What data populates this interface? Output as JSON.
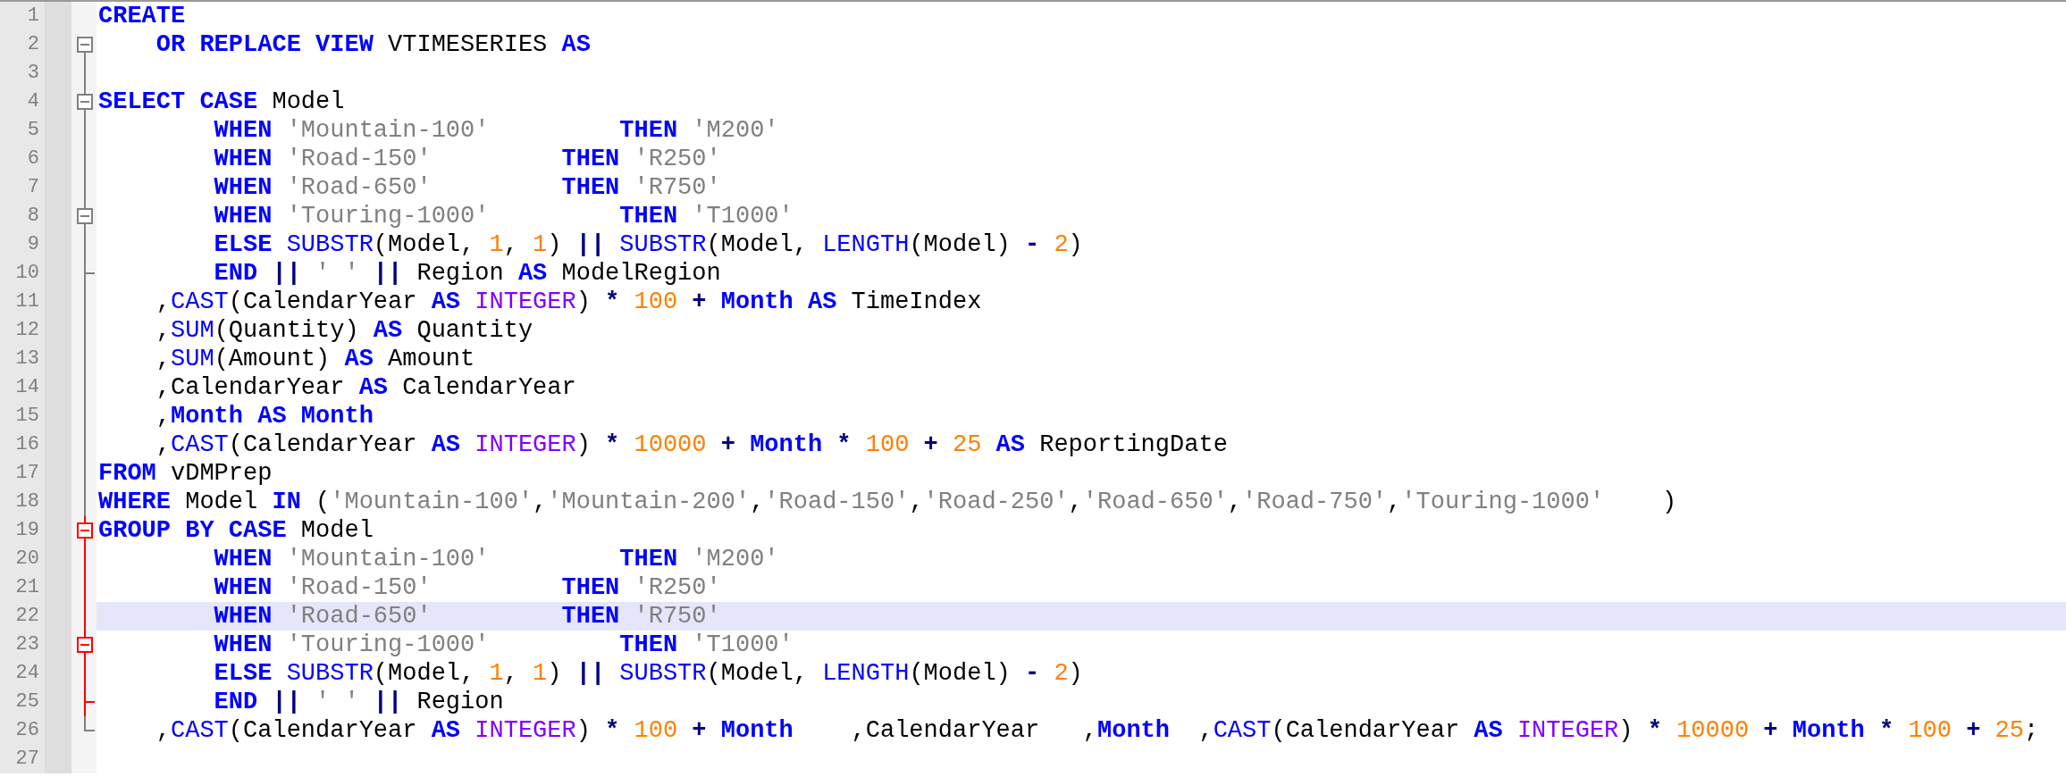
{
  "editor": {
    "lines": [
      {
        "number": "1",
        "selected": false,
        "kind": "none",
        "tokens": [
          {
            "kind": "kw",
            "text": "CREATE"
          }
        ]
      },
      {
        "number": "2",
        "selected": false,
        "kind": "start",
        "expanded": true,
        "fold_active": false,
        "tokens": [
          {
            "kind": "kw",
            "text": "    OR REPLACE VIEW "
          },
          {
            "kind": "plain",
            "text": "VTIMESERIES "
          },
          {
            "kind": "kw",
            "text": "AS"
          }
        ]
      },
      {
        "number": "3",
        "selected": false,
        "kind": "line",
        "fold_active": false
      },
      {
        "number": "4",
        "selected": false,
        "kind": "start",
        "expanded": true,
        "fold_active": false,
        "tokens": [
          {
            "kind": "kw",
            "text": "SELECT CASE "
          },
          {
            "kind": "plain",
            "text": "Model"
          }
        ]
      },
      {
        "number": "5",
        "selected": false,
        "kind": "line",
        "fold_active": false,
        "tokens": [
          {
            "kind": "kw",
            "text": "        WHEN "
          },
          {
            "kind": "str",
            "text": "'Mountain-100'         "
          },
          {
            "kind": "kw",
            "text": "THEN "
          },
          {
            "kind": "str",
            "text": "'M200'"
          }
        ]
      },
      {
        "number": "6",
        "selected": false,
        "kind": "line",
        "fold_active": false,
        "tokens": [
          {
            "kind": "kw",
            "text": "        WHEN "
          },
          {
            "kind": "str",
            "text": "'Road-150'         "
          },
          {
            "kind": "kw",
            "text": "THEN "
          },
          {
            "kind": "str",
            "text": "'R250'"
          }
        ]
      },
      {
        "number": "7",
        "selected": false,
        "kind": "line",
        "fold_active": false,
        "tokens": [
          {
            "kind": "kw",
            "text": "        WHEN "
          },
          {
            "kind": "str",
            "text": "'Road-650'         "
          },
          {
            "kind": "kw",
            "text": "THEN "
          },
          {
            "kind": "str",
            "text": "'R750'"
          }
        ]
      },
      {
        "number": "8",
        "selected": false,
        "kind": "start",
        "expanded": true,
        "fold_active": false,
        "tokens": [
          {
            "kind": "kw",
            "text": "        WHEN "
          },
          {
            "kind": "str",
            "text": "'Touring-1000'         "
          },
          {
            "kind": "kw",
            "text": "THEN "
          },
          {
            "kind": "str",
            "text": "'T1000'"
          }
        ]
      },
      {
        "number": "9",
        "selected": false,
        "kind": "line",
        "fold_active": false,
        "tokens": [
          {
            "kind": "kw",
            "text": "        ELSE "
          },
          {
            "kind": "fn",
            "text": "SUBSTR"
          },
          {
            "kind": "plain",
            "text": "(Model, "
          },
          {
            "kind": "num",
            "text": "1"
          },
          {
            "kind": "plain",
            "text": ", "
          },
          {
            "kind": "num",
            "text": "1"
          },
          {
            "kind": "plain",
            "text": ") "
          },
          {
            "kind": "op",
            "text": "|| "
          },
          {
            "kind": "fn",
            "text": "SUBSTR"
          },
          {
            "kind": "plain",
            "text": "(Model, "
          },
          {
            "kind": "fn",
            "text": "LENGTH"
          },
          {
            "kind": "plain",
            "text": "(Model) "
          },
          {
            "kind": "op",
            "text": "- "
          },
          {
            "kind": "num",
            "text": "2"
          },
          {
            "kind": "plain",
            "text": ")"
          }
        ]
      },
      {
        "number": "10",
        "selected": false,
        "kind": "end",
        "fold_active": false,
        "tokens": [
          {
            "kind": "kw",
            "text": "        END "
          },
          {
            "kind": "op",
            "text": "|| "
          },
          {
            "kind": "str",
            "text": "' ' "
          },
          {
            "kind": "op",
            "text": "|| "
          },
          {
            "kind": "plain",
            "text": "Region "
          },
          {
            "kind": "kw",
            "text": "AS "
          },
          {
            "kind": "plain",
            "text": "ModelRegion"
          }
        ]
      },
      {
        "number": "11",
        "selected": false,
        "kind": "line",
        "fold_active": false,
        "tokens": [
          {
            "kind": "plain",
            "text": "    ,"
          },
          {
            "kind": "fn",
            "text": "CAST"
          },
          {
            "kind": "plain",
            "text": "(CalendarYear "
          },
          {
            "kind": "kw",
            "text": "AS "
          },
          {
            "kind": "type",
            "text": "INTEGER"
          },
          {
            "kind": "plain",
            "text": ") "
          },
          {
            "kind": "op",
            "text": "* "
          },
          {
            "kind": "num",
            "text": "100 "
          },
          {
            "kind": "op",
            "text": "+ "
          },
          {
            "kind": "kw",
            "text": "Month AS "
          },
          {
            "kind": "plain",
            "text": "TimeIndex"
          }
        ]
      },
      {
        "number": "12",
        "selected": false,
        "kind": "line",
        "fold_active": false,
        "tokens": [
          {
            "kind": "plain",
            "text": "    ,"
          },
          {
            "kind": "fn",
            "text": "SUM"
          },
          {
            "kind": "plain",
            "text": "(Quantity) "
          },
          {
            "kind": "kw",
            "text": "AS "
          },
          {
            "kind": "plain",
            "text": "Quantity"
          }
        ]
      },
      {
        "number": "13",
        "selected": false,
        "kind": "line",
        "fold_active": false,
        "tokens": [
          {
            "kind": "plain",
            "text": "    ,"
          },
          {
            "kind": "fn",
            "text": "SUM"
          },
          {
            "kind": "plain",
            "text": "(Amount) "
          },
          {
            "kind": "kw",
            "text": "AS "
          },
          {
            "kind": "plain",
            "text": "Amount"
          }
        ]
      },
      {
        "number": "14",
        "selected": false,
        "kind": "line",
        "fold_active": false,
        "tokens": [
          {
            "kind": "plain",
            "text": "    ,CalendarYear "
          },
          {
            "kind": "kw",
            "text": "AS "
          },
          {
            "kind": "plain",
            "text": "CalendarYear"
          }
        ]
      },
      {
        "number": "15",
        "selected": false,
        "kind": "line",
        "fold_active": false,
        "tokens": [
          {
            "kind": "plain",
            "text": "    ,"
          },
          {
            "kind": "kw",
            "text": "Month AS Month"
          }
        ]
      },
      {
        "number": "16",
        "selected": false,
        "kind": "line",
        "fold_active": false,
        "tokens": [
          {
            "kind": "plain",
            "text": "    ,"
          },
          {
            "kind": "fn",
            "text": "CAST"
          },
          {
            "kind": "plain",
            "text": "(CalendarYear "
          },
          {
            "kind": "kw",
            "text": "AS "
          },
          {
            "kind": "type",
            "text": "INTEGER"
          },
          {
            "kind": "plain",
            "text": ") "
          },
          {
            "kind": "op",
            "text": "* "
          },
          {
            "kind": "num",
            "text": "10000 "
          },
          {
            "kind": "op",
            "text": "+ "
          },
          {
            "kind": "kw",
            "text": "Month "
          },
          {
            "kind": "op",
            "text": "* "
          },
          {
            "kind": "num",
            "text": "100 "
          },
          {
            "kind": "op",
            "text": "+ "
          },
          {
            "kind": "num",
            "text": "25 "
          },
          {
            "kind": "kw",
            "text": "AS "
          },
          {
            "kind": "plain",
            "text": "ReportingDate"
          }
        ]
      },
      {
        "number": "17",
        "selected": false,
        "kind": "line",
        "fold_active": false,
        "tokens": [
          {
            "kind": "kw",
            "text": "FROM "
          },
          {
            "kind": "plain",
            "text": "vDMPrep"
          }
        ]
      },
      {
        "number": "18",
        "selected": false,
        "kind": "line",
        "fold_active": false,
        "tokens": [
          {
            "kind": "kw",
            "text": "WHERE "
          },
          {
            "kind": "plain",
            "text": "Model "
          },
          {
            "kind": "kw",
            "text": "IN "
          },
          {
            "kind": "plain",
            "text": "("
          },
          {
            "kind": "str",
            "text": "'Mountain-100'"
          },
          {
            "kind": "plain",
            "text": ","
          },
          {
            "kind": "str",
            "text": "'Mountain-200'"
          },
          {
            "kind": "plain",
            "text": ","
          },
          {
            "kind": "str",
            "text": "'Road-150'"
          },
          {
            "kind": "plain",
            "text": ","
          },
          {
            "kind": "str",
            "text": "'Road-250'"
          },
          {
            "kind": "plain",
            "text": ","
          },
          {
            "kind": "str",
            "text": "'Road-650'"
          },
          {
            "kind": "plain",
            "text": ","
          },
          {
            "kind": "str",
            "text": "'Road-750'"
          },
          {
            "kind": "plain",
            "text": ","
          },
          {
            "kind": "str",
            "text": "'Touring-1000'    "
          },
          {
            "kind": "plain",
            "text": ")"
          }
        ]
      },
      {
        "number": "19",
        "selected": false,
        "kind": "start",
        "expanded": true,
        "fold_active": true,
        "tokens": [
          {
            "kind": "kw",
            "text": "GROUP BY CASE "
          },
          {
            "kind": "plain",
            "text": "Model"
          }
        ]
      },
      {
        "number": "20",
        "selected": false,
        "kind": "line",
        "fold_active": true,
        "tokens": [
          {
            "kind": "kw",
            "text": "        WHEN "
          },
          {
            "kind": "str",
            "text": "'Mountain-100'         "
          },
          {
            "kind": "kw",
            "text": "THEN "
          },
          {
            "kind": "str",
            "text": "'M200'"
          }
        ]
      },
      {
        "number": "21",
        "selected": false,
        "kind": "line",
        "fold_active": true,
        "tokens": [
          {
            "kind": "kw",
            "text": "        WHEN "
          },
          {
            "kind": "str",
            "text": "'Road-150'         "
          },
          {
            "kind": "kw",
            "text": "THEN "
          },
          {
            "kind": "str",
            "text": "'R250'"
          }
        ]
      },
      {
        "number": "22",
        "selected": true,
        "kind": "line",
        "fold_active": true,
        "tokens": [
          {
            "kind": "kw",
            "text": "        WHEN "
          },
          {
            "kind": "str",
            "text": "'Road-650'         "
          },
          {
            "kind": "kw",
            "text": "THEN "
          },
          {
            "kind": "str",
            "text": "'R750'"
          }
        ]
      },
      {
        "number": "23",
        "selected": false,
        "kind": "start",
        "expanded": true,
        "fold_active": true,
        "tokens": [
          {
            "kind": "kw",
            "text": "        WHEN "
          },
          {
            "kind": "str",
            "text": "'Touring-1000'         "
          },
          {
            "kind": "kw",
            "text": "THEN "
          },
          {
            "kind": "str",
            "text": "'T1000'"
          }
        ]
      },
      {
        "number": "24",
        "selected": false,
        "kind": "line",
        "fold_active": true,
        "tokens": [
          {
            "kind": "kw",
            "text": "        ELSE "
          },
          {
            "kind": "fn",
            "text": "SUBSTR"
          },
          {
            "kind": "plain",
            "text": "(Model, "
          },
          {
            "kind": "num",
            "text": "1"
          },
          {
            "kind": "plain",
            "text": ", "
          },
          {
            "kind": "num",
            "text": "1"
          },
          {
            "kind": "plain",
            "text": ") "
          },
          {
            "kind": "op",
            "text": "|| "
          },
          {
            "kind": "fn",
            "text": "SUBSTR"
          },
          {
            "kind": "plain",
            "text": "(Model, "
          },
          {
            "kind": "fn",
            "text": "LENGTH"
          },
          {
            "kind": "plain",
            "text": "(Model) "
          },
          {
            "kind": "op",
            "text": "- "
          },
          {
            "kind": "num",
            "text": "2"
          },
          {
            "kind": "plain",
            "text": ")"
          }
        ]
      },
      {
        "number": "25",
        "selected": false,
        "kind": "end",
        "fold_active": true,
        "tokens": [
          {
            "kind": "kw",
            "text": "        END "
          },
          {
            "kind": "op",
            "text": "|| "
          },
          {
            "kind": "str",
            "text": "' ' "
          },
          {
            "kind": "op",
            "text": "|| "
          },
          {
            "kind": "plain",
            "text": "Region"
          }
        ]
      },
      {
        "number": "26",
        "selected": false,
        "kind": "last",
        "fold_active": false,
        "tokens": [
          {
            "kind": "plain",
            "text": "    ,"
          },
          {
            "kind": "fn",
            "text": "CAST"
          },
          {
            "kind": "plain",
            "text": "(CalendarYear "
          },
          {
            "kind": "kw",
            "text": "AS "
          },
          {
            "kind": "type",
            "text": "INTEGER"
          },
          {
            "kind": "plain",
            "text": ") "
          },
          {
            "kind": "op",
            "text": "* "
          },
          {
            "kind": "num",
            "text": "100 "
          },
          {
            "kind": "op",
            "text": "+ "
          },
          {
            "kind": "kw",
            "text": "Month"
          },
          {
            "kind": "plain",
            "text": "    ,CalendarYear   ,"
          },
          {
            "kind": "kw",
            "text": "Month"
          },
          {
            "kind": "plain",
            "text": "  ,"
          },
          {
            "kind": "fn",
            "text": "CAST"
          },
          {
            "kind": "plain",
            "text": "(CalendarYear "
          },
          {
            "kind": "kw",
            "text": "AS "
          },
          {
            "kind": "type",
            "text": "INTEGER"
          },
          {
            "kind": "plain",
            "text": ") "
          },
          {
            "kind": "op",
            "text": "* "
          },
          {
            "kind": "num",
            "text": "10000 "
          },
          {
            "kind": "op",
            "text": "+ "
          },
          {
            "kind": "kw",
            "text": "Month "
          },
          {
            "kind": "op",
            "text": "* "
          },
          {
            "kind": "num",
            "text": "100 "
          },
          {
            "kind": "op",
            "text": "+ "
          },
          {
            "kind": "num",
            "text": "25"
          },
          {
            "kind": "plain",
            "text": ";"
          }
        ]
      },
      {
        "number": "27",
        "selected": false,
        "kind": "none"
      }
    ]
  }
}
